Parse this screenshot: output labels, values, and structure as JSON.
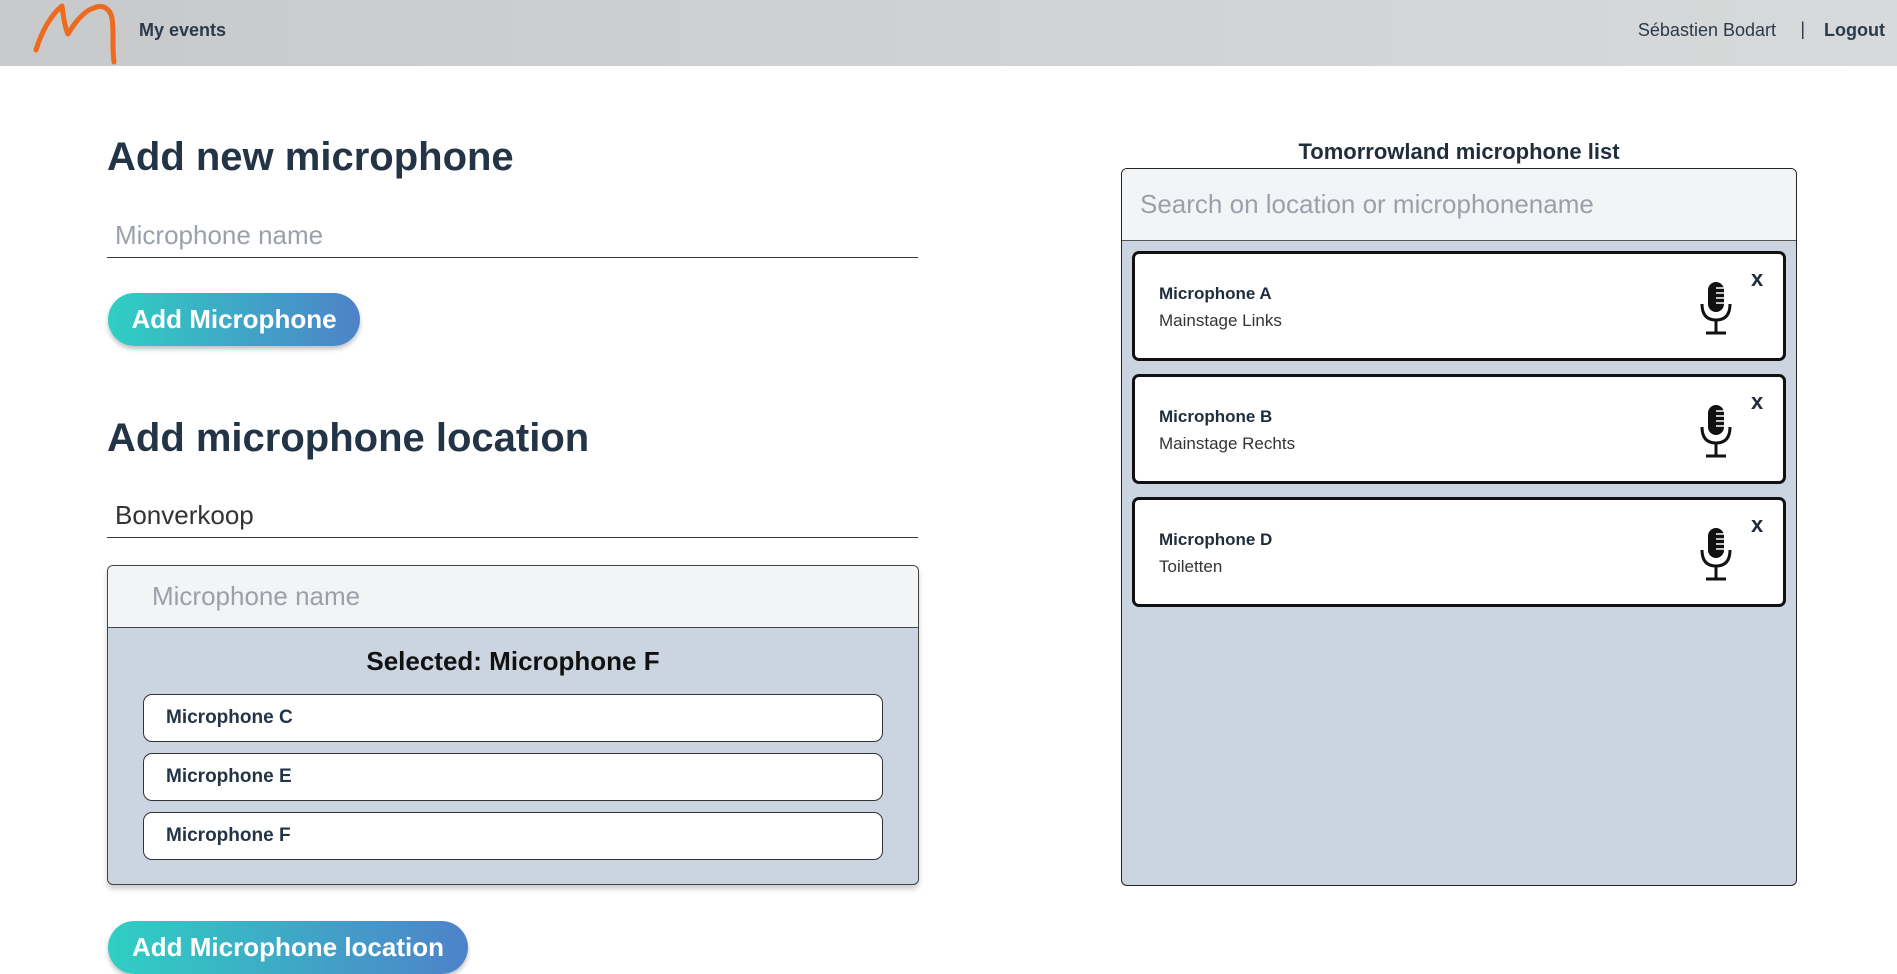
{
  "nav": {
    "my_events": "My events",
    "user_name": "Sébastien Bodart",
    "separator": "|",
    "logout": "Logout"
  },
  "add_microphone": {
    "title": "Add new microphone",
    "name_placeholder": "Microphone name",
    "button_label": "Add Microphone"
  },
  "add_location": {
    "title": "Add microphone location",
    "location_value": "Bonverkoop",
    "picker_placeholder": "Microphone name",
    "selected_label": "Selected: Microphone F",
    "options": [
      "Microphone C",
      "Microphone E",
      "Microphone F"
    ],
    "button_label": "Add Microphone location"
  },
  "mic_list": {
    "title": "Tomorrowland microphone list",
    "search_placeholder": "Search on location or microphonename",
    "items": [
      {
        "name": "Microphone A",
        "location": "Mainstage Links",
        "remove": "x",
        "icon": "microphone-icon"
      },
      {
        "name": "Microphone B",
        "location": "Mainstage Rechts",
        "remove": "x",
        "icon": "microphone-icon"
      },
      {
        "name": "Microphone D",
        "location": "Toiletten",
        "remove": "x",
        "icon": "microphone-icon"
      }
    ]
  },
  "colors": {
    "logo_orange": "#ee6a1f",
    "button_gradient_start": "#2fcfc3",
    "button_gradient_end": "#4e82c9",
    "panel_bg": "#cbd5e1",
    "heading": "#243447"
  }
}
